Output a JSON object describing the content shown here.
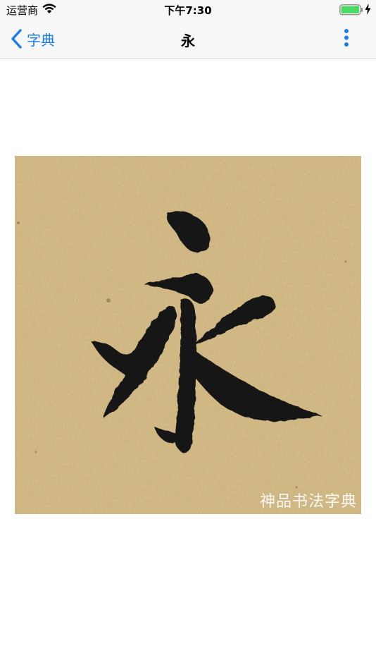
{
  "status_bar": {
    "carrier": "运营商",
    "time": "下午7:30",
    "wifi_icon": "wifi-icon",
    "battery_icon": "battery-icon",
    "charging_icon": "charging-icon"
  },
  "nav_bar": {
    "back_label": "字典",
    "back_icon": "chevron-left-icon",
    "title": "永",
    "more_icon": "more-vertical-icon"
  },
  "content": {
    "image_watermark": "神品书法字典"
  },
  "colors": {
    "accent": "#1a7cf2",
    "paper": "#d6bb84",
    "ink": "#161616",
    "battery": "#4cd964"
  }
}
